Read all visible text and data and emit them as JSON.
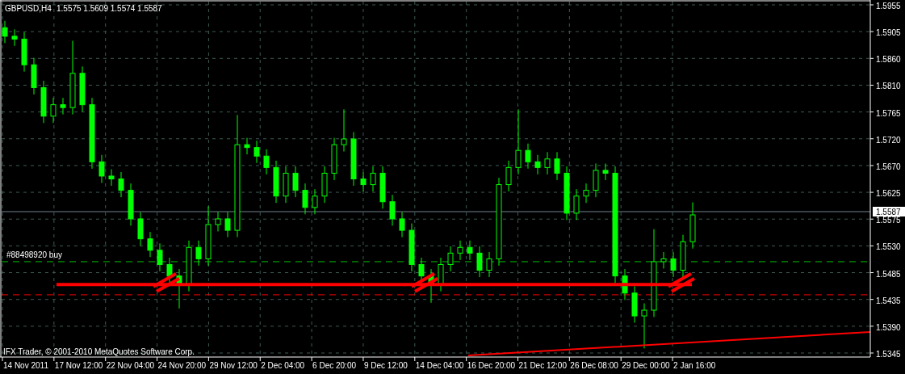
{
  "chart": {
    "symbol": "GBPUSD,H4",
    "ohlc": "1.5575 1.5609 1.5574 1.5587",
    "order_label": "#88498920 buy",
    "bid_label": "1.5587",
    "copyright": "IFX Trader, © 2001-2010 MetaQuotes Software Corp.",
    "price_axis": [
      "1.5955",
      "1.5905",
      "1.5860",
      "1.5810",
      "1.5765",
      "1.5720",
      "1.5670",
      "1.5625",
      "1.5575",
      "1.5530",
      "1.5485",
      "1.5435",
      "1.5390",
      "1.5345"
    ],
    "time_axis": [
      "14 Nov 2011",
      "17 Nov 12:00",
      "22 Nov 04:00",
      "24 Nov 20:00",
      "29 Nov 12:00",
      "2 Dec 04:00",
      "6 Dec 20:00",
      "9 Dec 12:00",
      "14 Dec 04:00",
      "16 Dec 20:00",
      "21 Dec 12:00",
      "26 Dec 08:00",
      "29 Dec 00:00",
      "2 Jan 16:00"
    ]
  }
}
